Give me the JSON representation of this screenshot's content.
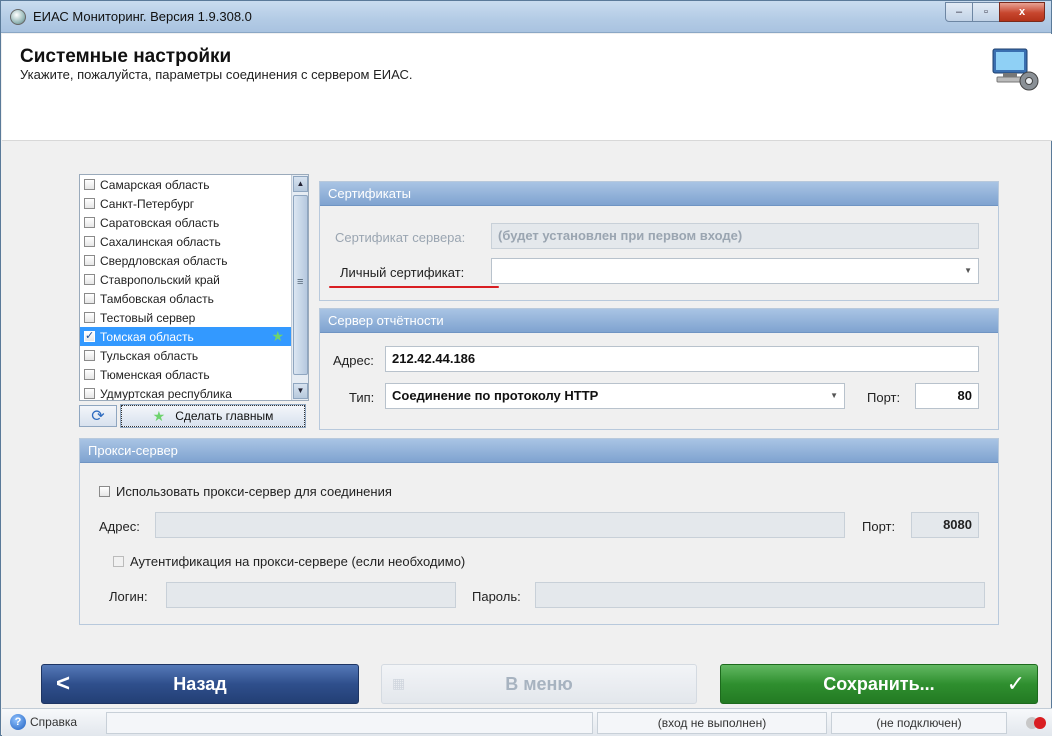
{
  "window": {
    "title": "ЕИАС Мониторинг. Версия 1.9.308.0",
    "min": "–",
    "max": "▫",
    "close": "x"
  },
  "header": {
    "title": "Системные настройки",
    "subtitle": "Укажите, пожалуйста, параметры соединения с сервером ЕИАС."
  },
  "regions": {
    "items": [
      {
        "label": "Самарская область",
        "checked": false
      },
      {
        "label": "Санкт-Петербург",
        "checked": false
      },
      {
        "label": "Саратовская область",
        "checked": false
      },
      {
        "label": "Сахалинская область",
        "checked": false
      },
      {
        "label": "Свердловская область",
        "checked": false
      },
      {
        "label": "Ставропольский край",
        "checked": false
      },
      {
        "label": "Тамбовская область",
        "checked": false
      },
      {
        "label": "Тестовый сервер",
        "checked": false
      },
      {
        "label": "Томская область",
        "checked": true,
        "selected": true,
        "main": true
      },
      {
        "label": "Тульская область",
        "checked": false
      },
      {
        "label": "Тюменская область",
        "checked": false
      },
      {
        "label": "Удмуртская республика",
        "checked": false
      }
    ],
    "refresh_icon": "refresh-icon",
    "make_main_label": "Сделать главным"
  },
  "certificates": {
    "heading": "Сертификаты",
    "server_label": "Сертификат сервера:",
    "server_value": "(будет установлен при первом входе)",
    "personal_label": "Личный сертификат:",
    "personal_value": ""
  },
  "server": {
    "heading": "Сервер отчётности",
    "address_label": "Адрес:",
    "address_value": "212.42.44.186",
    "type_label": "Тип:",
    "type_value": "Соединение по протоколу HTTP",
    "port_label": "Порт:",
    "port_value": "80"
  },
  "proxy": {
    "heading": "Прокси-сервер",
    "use_label": "Использовать прокси-сервер для соединения",
    "address_label": "Адрес:",
    "address_value": "",
    "port_label": "Порт:",
    "port_value": "8080",
    "auth_label": "Аутентификация на прокси-сервере (если необходимо)",
    "login_label": "Логин:",
    "login_value": "",
    "password_label": "Пароль:",
    "password_value": ""
  },
  "buttons": {
    "back": "Назад",
    "menu": "В меню",
    "save": "Сохранить..."
  },
  "status": {
    "help": "Справка",
    "login_state": "(вход не выполнен)",
    "connection_state": "(не подключен)"
  },
  "colors": {
    "accent": "#3399ff",
    "save": "#2f8f2f",
    "back": "#2f4f8c",
    "alert": "#d91e22"
  }
}
